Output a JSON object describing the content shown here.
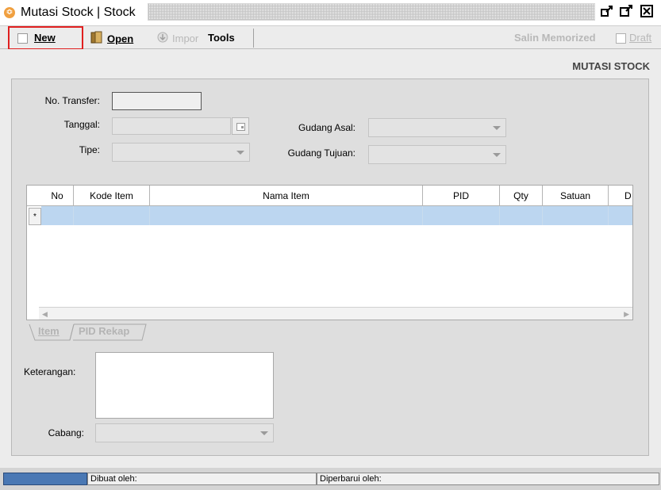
{
  "window": {
    "title": "Mutasi Stock | Stock",
    "icon": "app-logo-icon",
    "controls": [
      "restore-icon",
      "maximize-icon",
      "close-icon"
    ]
  },
  "toolbar": {
    "new_label": "New",
    "open_label": "Open",
    "import_label": "Impor",
    "tools_label": "Tools",
    "salin_memorized_label": "Salin Memorized",
    "draft_label": "Draft"
  },
  "form": {
    "title": "MUTASI STOCK",
    "no_transfer_label": "No. Transfer:",
    "no_transfer_value": "",
    "tanggal_label": "Tanggal:",
    "tanggal_value": "",
    "tipe_label": "Tipe:",
    "tipe_value": "",
    "gudang_asal_label": "Gudang Asal:",
    "gudang_asal_value": "",
    "gudang_tujuan_label": "Gudang Tujuan:",
    "gudang_tujuan_value": "",
    "keterangan_label": "Keterangan:",
    "keterangan_value": "",
    "cabang_label": "Cabang:",
    "cabang_value": ""
  },
  "grid": {
    "columns": [
      "No",
      "Kode Item",
      "Nama Item",
      "PID",
      "Qty",
      "Satuan",
      "D"
    ],
    "new_row_marker": "*"
  },
  "tabs": {
    "item_label": "Item",
    "pid_rekap_label": "PID Rekap"
  },
  "statusbar": {
    "dibuat_oleh_label": "Dibuat oleh:",
    "diperbarui_oleh_label": "Diperbarui oleh:"
  },
  "colors": {
    "accent_highlight": "#e02020",
    "selected_row": "#bcd6f0",
    "status_block": "#4a78b4"
  }
}
